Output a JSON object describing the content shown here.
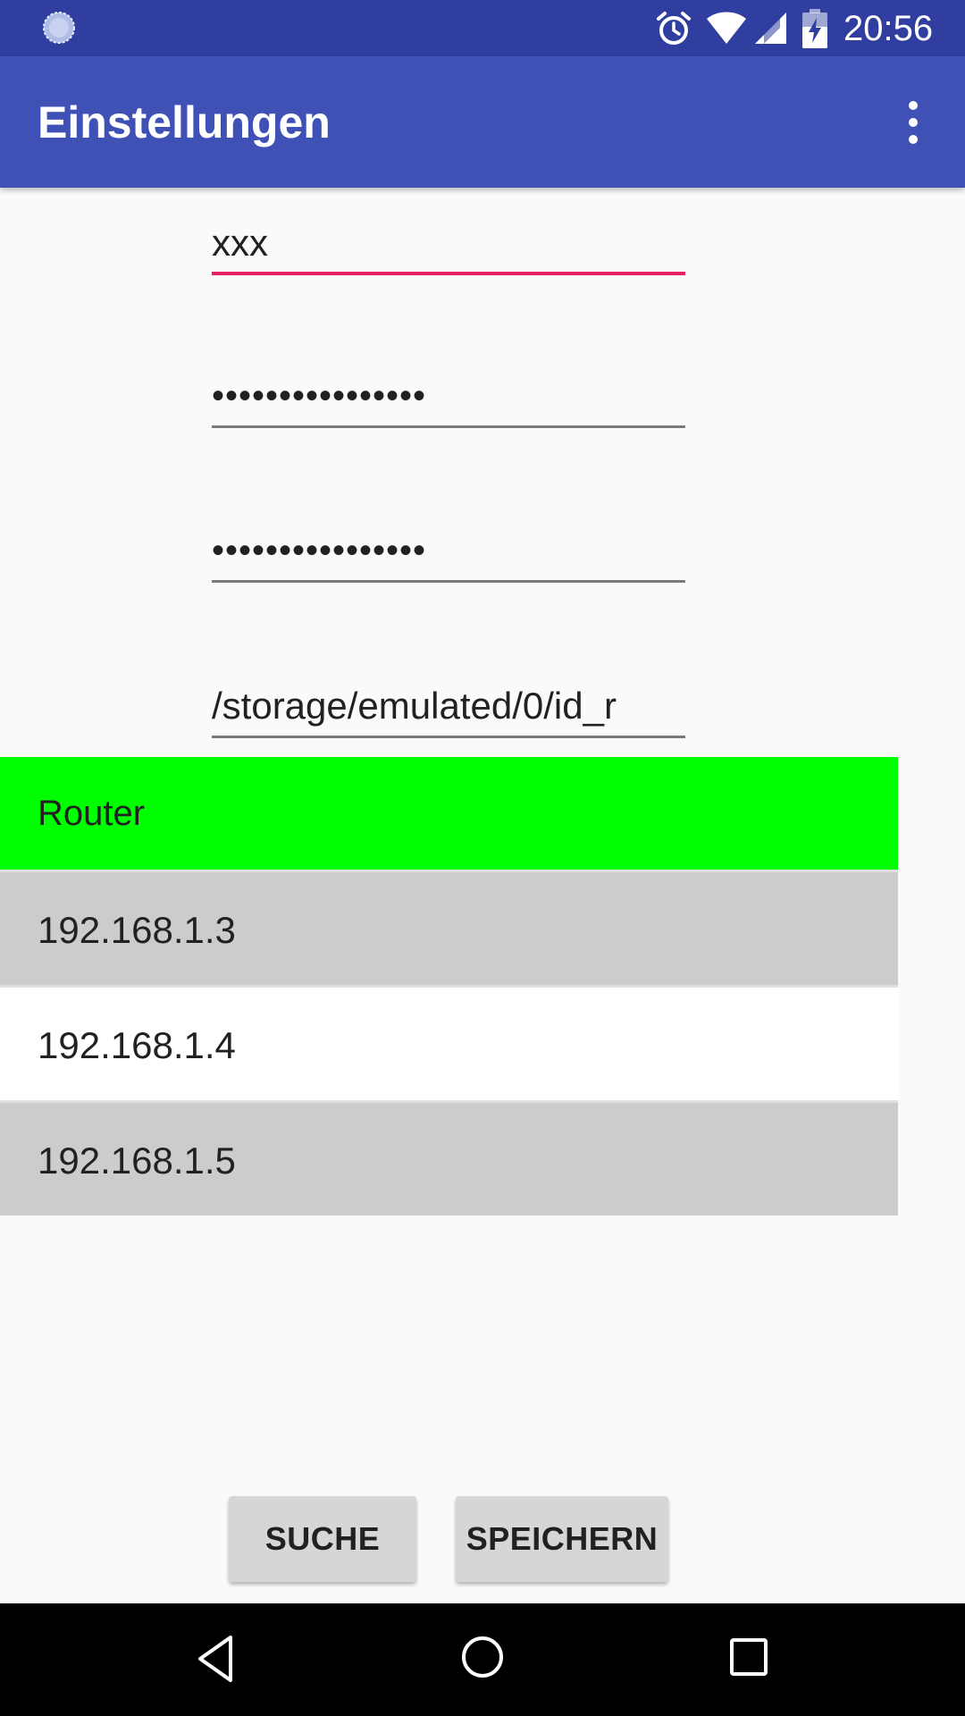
{
  "status_bar": {
    "time": "20:56",
    "icons": [
      "sync-icon",
      "alarm-icon",
      "wifi-icon",
      "signal-icon",
      "battery-charging-icon"
    ]
  },
  "toolbar": {
    "title": "Einstellungen",
    "overflow_icon": "more-vert-icon",
    "background": "#3f51b5"
  },
  "form": {
    "field1_value": "xxx",
    "field2_value": "••••••••••••••••",
    "field3_value": "••••••••••••••••",
    "field4_value": "/storage/emulated/0/id_r"
  },
  "list": {
    "header": "Router",
    "header_color": "#00ff00",
    "items": [
      {
        "label": "192.168.1.3"
      },
      {
        "label": "192.168.1.4"
      },
      {
        "label": "192.168.1.5"
      }
    ]
  },
  "buttons": {
    "search_label": "SUCHE",
    "save_label": "SPEICHERN"
  },
  "nav_bar": {
    "icons": [
      "back-icon",
      "home-icon",
      "recents-icon"
    ]
  },
  "colors": {
    "status_bar": "#303f9f",
    "accent": "#e91e63"
  }
}
